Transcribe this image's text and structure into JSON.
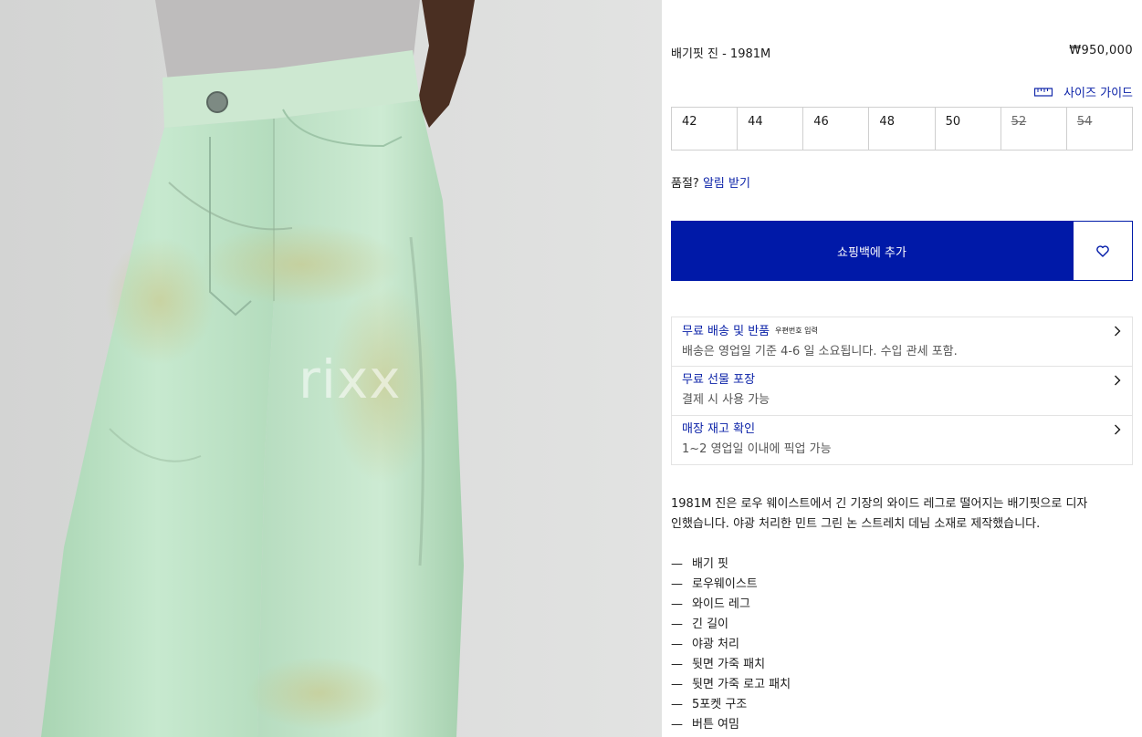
{
  "image": {
    "alt_icon": "product-photo",
    "watermark": "rixx"
  },
  "product": {
    "name": "배기핏 진 - 1981M",
    "price": "₩950,000"
  },
  "size_guide": {
    "label": "사이즈 가이드",
    "icon": "ruler-icon"
  },
  "sizes": [
    {
      "label": "42",
      "available": true
    },
    {
      "label": "44",
      "available": true
    },
    {
      "label": "46",
      "available": true
    },
    {
      "label": "48",
      "available": true
    },
    {
      "label": "50",
      "available": true
    },
    {
      "label": "52",
      "available": false
    },
    {
      "label": "54",
      "available": false
    }
  ],
  "soldout": {
    "prefix": "품절?",
    "notify_label": "알림 받기"
  },
  "actions": {
    "add_to_bag_label": "쇼핑백에 추가",
    "wishlist_icon": "heart-icon"
  },
  "services": [
    {
      "title": "무료 배송 및 반품",
      "tag": "우편번호 입력",
      "subtitle": "배송은 영업일 기준 4-6 일 소요됩니다. 수입 관세 포함."
    },
    {
      "title": "무료 선물 포장",
      "tag": "",
      "subtitle": "결제 시 사용 가능"
    },
    {
      "title": "매장 재고 확인",
      "tag": "",
      "subtitle": "1~2 영업일 이내에 픽업 가능"
    }
  ],
  "description": {
    "line1": "1981M 진은 로우 웨이스트에서 긴 기장의 와이드 레그로 떨어지는 배기핏으로 디자",
    "line2": "인했습니다. 야광 처리한 민트 그린 논 스트레치 데님 소재로 제작했습니다."
  },
  "features": [
    "배기 핏",
    "로우웨이스트",
    "와이드 레그",
    "긴 길이",
    "야광 처리",
    "뒷면 가죽 패치",
    "뒷면 가죽 로고 패치",
    "5포켓 구조",
    "버튼 여밈"
  ],
  "colors": {
    "accent": "#0019a8",
    "link": "#0b22a8",
    "denim": "#bfe3c8",
    "background_image": "#dddedd"
  }
}
